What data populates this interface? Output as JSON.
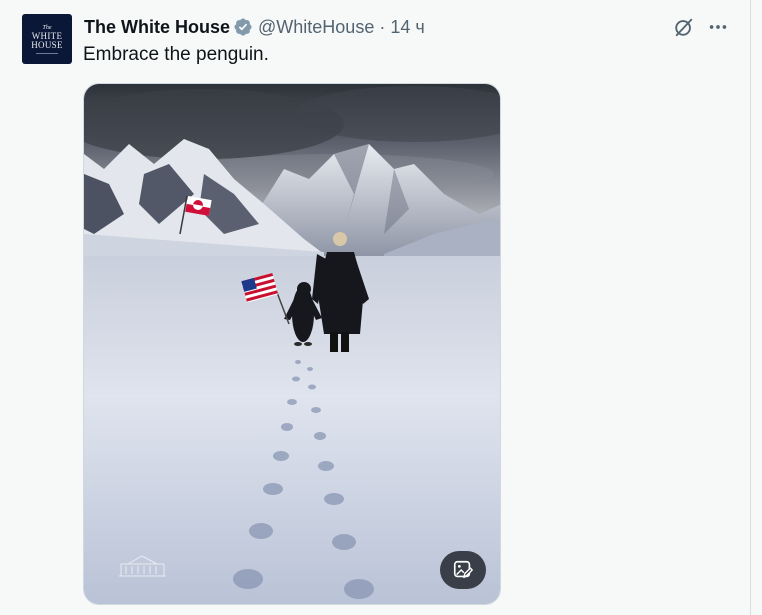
{
  "tweet": {
    "author_name": "The White House",
    "handle": "@WhiteHouse",
    "separator": "·",
    "time": "14 ч",
    "text": "Embrace the penguin.",
    "avatar": {
      "line1": "The",
      "line2": "WHITE",
      "line3": "HOUSE"
    },
    "verified": true,
    "icons": {
      "verified": "verified-badge-icon",
      "grok": "grok-icon",
      "more": "more-options-icon",
      "alt": "image-edit-icon",
      "watermark": "white-house-logo"
    },
    "image_description_colors": {
      "verified": "#829aab",
      "text": "#0f1419",
      "secondary": "#536471"
    }
  }
}
